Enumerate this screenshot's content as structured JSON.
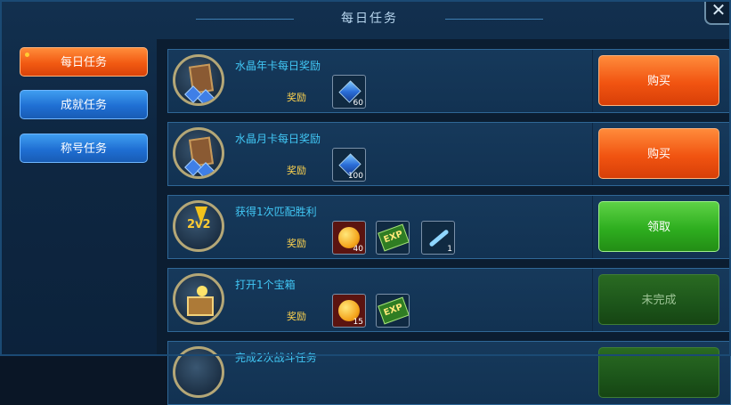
{
  "title": "每日任务",
  "close_symbol": "✕",
  "tabs": [
    {
      "label": "每日任务",
      "active": true
    },
    {
      "label": "成就任务",
      "active": false
    },
    {
      "label": "称号任务",
      "active": false
    }
  ],
  "reward_label": "奖励",
  "tasks": [
    {
      "name": "水晶年卡每日奖励",
      "rewards": [
        {
          "icon": "crystal-icon",
          "count": "60"
        }
      ],
      "action": "购买",
      "action_state": "orange"
    },
    {
      "name": "水晶月卡每日奖励",
      "rewards": [
        {
          "icon": "crystal-icon",
          "count": "100"
        }
      ],
      "action": "购买",
      "action_state": "orange"
    },
    {
      "name": "获得1次匹配胜利",
      "rewards": [
        {
          "icon": "gold-coin-icon",
          "count": "40"
        },
        {
          "icon": "exp-icon",
          "count": ""
        },
        {
          "icon": "key-icon",
          "count": "1"
        }
      ],
      "action": "领取",
      "action_state": "green"
    },
    {
      "name": "打开1个宝箱",
      "rewards": [
        {
          "icon": "gold-coin-icon",
          "count": "15"
        },
        {
          "icon": "exp-icon",
          "count": ""
        }
      ],
      "action": "未完成",
      "action_state": "darkgreen"
    },
    {
      "name": "完成2次战斗任务",
      "rewards": [],
      "action": "",
      "action_state": "darkgreen"
    }
  ],
  "colors": {
    "active_tab": "#f25a12",
    "inactive_tab": "#1f6fd3",
    "task_name": "#41c7f5",
    "reward_label": "#ffd44f",
    "buy_button": "#f15411",
    "claim_button": "#2eae1f",
    "incomplete_button": "#1c551a"
  }
}
